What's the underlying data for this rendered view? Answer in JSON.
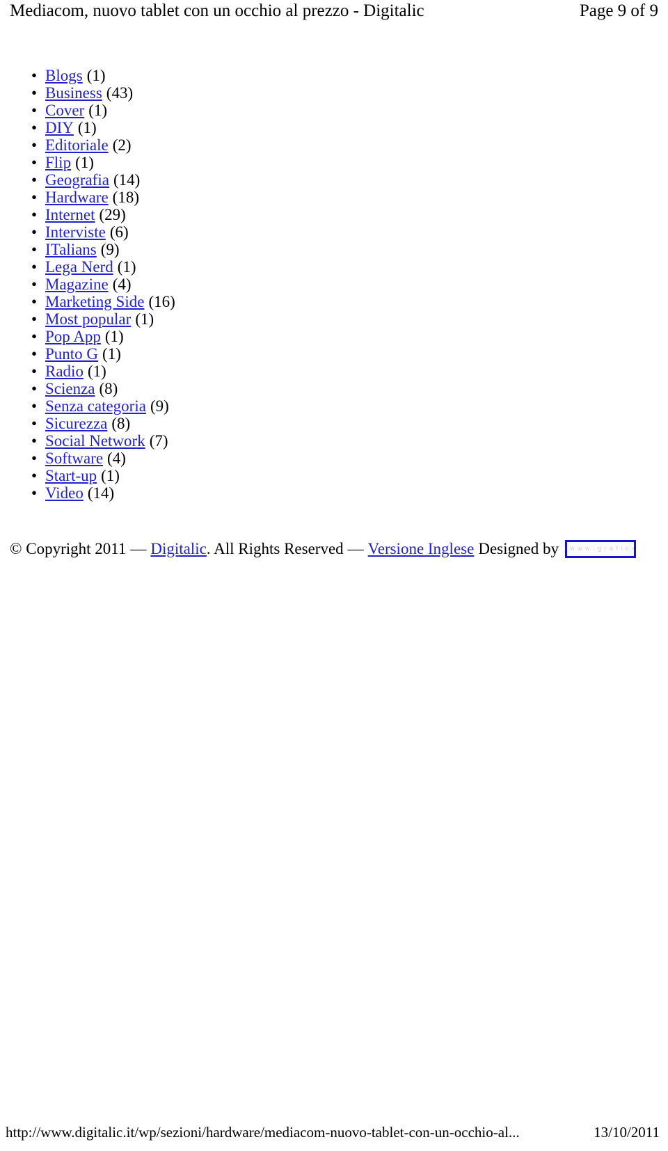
{
  "header": {
    "title": "Mediacom, nuovo tablet con un occhio al prezzo - Digitalic",
    "page_indicator": "Page 9 of 9"
  },
  "categories": {
    "items": [
      {
        "label": "Blogs",
        "count": "(1)"
      },
      {
        "label": "Business",
        "count": "(43)"
      },
      {
        "label": "Cover",
        "count": "(1)"
      },
      {
        "label": "DIY",
        "count": "(1)"
      },
      {
        "label": "Editoriale",
        "count": "(2)"
      },
      {
        "label": "Flip",
        "count": "(1)"
      },
      {
        "label": "Geografia",
        "count": "(14)"
      },
      {
        "label": "Hardware",
        "count": "(18)"
      },
      {
        "label": "Internet",
        "count": "(29)"
      },
      {
        "label": "Interviste",
        "count": "(6)"
      },
      {
        "label": "ITalians",
        "count": "(9)"
      },
      {
        "label": "Lega Nerd",
        "count": "(1)"
      },
      {
        "label": "Magazine",
        "count": "(4)"
      },
      {
        "label": "Marketing Side",
        "count": "(16)"
      },
      {
        "label": "Most popular",
        "count": "(1)"
      },
      {
        "label": "Pop App",
        "count": "(1)"
      },
      {
        "label": "Punto G",
        "count": "(1)"
      },
      {
        "label": "Radio",
        "count": "(1)"
      },
      {
        "label": "Scienza",
        "count": "(8)"
      },
      {
        "label": "Senza categoria",
        "count": "(9)"
      },
      {
        "label": "Sicurezza",
        "count": "(8)"
      },
      {
        "label": "Social Network",
        "count": "(7)"
      },
      {
        "label": "Software",
        "count": "(4)"
      },
      {
        "label": "Start-up",
        "count": "(1)"
      },
      {
        "label": "Video",
        "count": "(14)"
      }
    ],
    "bullet_glyph": "•"
  },
  "copyright": {
    "prefix": "© Copyright 2011",
    "dash_one": "—",
    "site_link": "Digitalic",
    "middle": ". All Rights Reserved",
    "dash_two": "—",
    "language_link": "Versione Inglese",
    "designed_by": "Designed by",
    "logo_alt_text": "designed by logo"
  },
  "footer": {
    "url": "http://www.digitalic.it/wp/sezioni/hardware/mediacom-nuovo-tablet-con-un-occhio-al...",
    "date": "13/10/2011"
  },
  "colors": {
    "link": "#2222cc",
    "text": "#000000",
    "logo_border": "#1515cc",
    "page_background": "#ffffff"
  }
}
